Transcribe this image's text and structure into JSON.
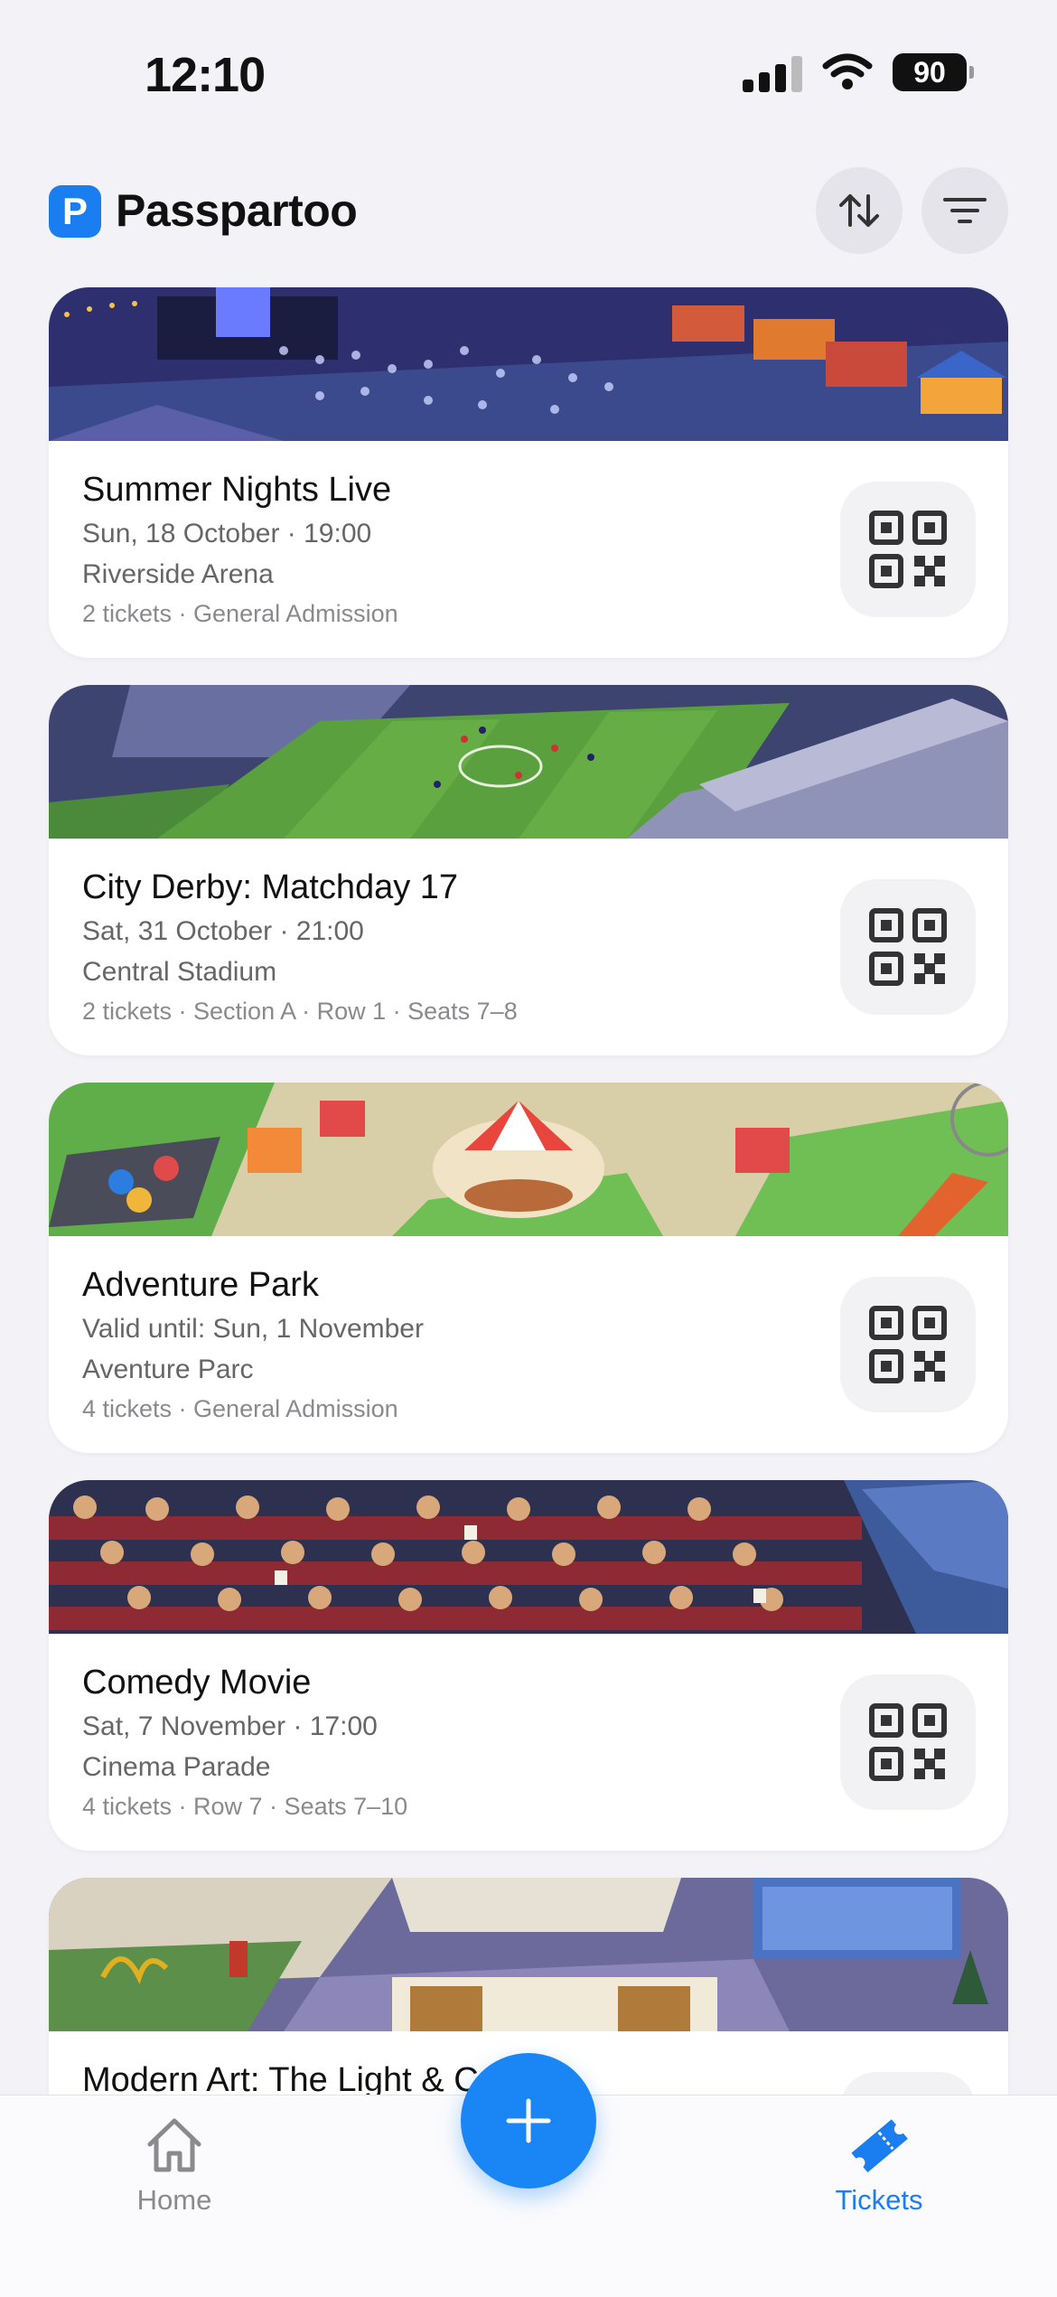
{
  "status_bar": {
    "time": "12:10",
    "battery": "90"
  },
  "header": {
    "logo_letter": "P",
    "title": "Passpartoo",
    "accent": "#1a7df0"
  },
  "tickets": [
    {
      "title": "Summer Nights Live",
      "date": "Sun, 18 October · 19:00",
      "venue": "Riverside Arena",
      "meta": "2 tickets · General Admission"
    },
    {
      "title": "City Derby: Matchday 17",
      "date": "Sat, 31 October · 21:00",
      "venue": "Central Stadium",
      "meta": "2 tickets · Section A · Row 1 · Seats 7–8"
    },
    {
      "title": "Adventure Park",
      "date": "Valid until: Sun, 1 November",
      "venue": "Aventure Parc",
      "meta": "4 tickets · General Admission"
    },
    {
      "title": "Comedy Movie",
      "date": "Sat, 7 November · 17:00",
      "venue": "Cinema Parade",
      "meta": "4 tickets · Row 7 · Seats 7–10"
    },
    {
      "title": "Modern Art: The Light & C",
      "date": "",
      "venue": "",
      "meta": ""
    }
  ],
  "tab_bar": {
    "home_label": "Home",
    "tickets_label": "Tickets",
    "active_tab": "Tickets"
  }
}
